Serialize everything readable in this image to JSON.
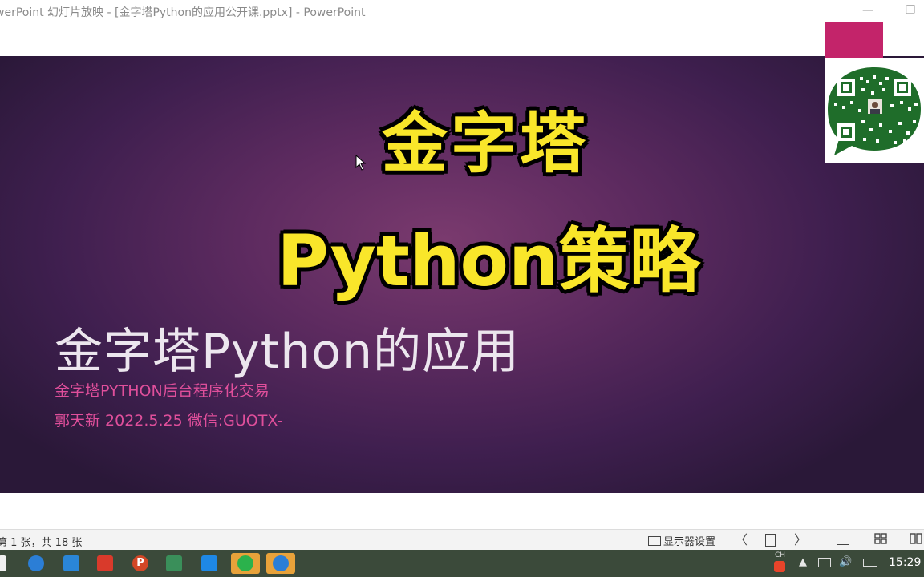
{
  "window": {
    "title": "werPoint 幻灯片放映 - [金字塔Python的应用公开课.pptx] - PowerPoint",
    "minimize_glyph": "—",
    "restore_glyph": "❐"
  },
  "slide": {
    "overlay_line1": "金字塔",
    "overlay_line2": "Python策略",
    "title": "金字塔Python的应用",
    "subtitle1": "金字塔PYTHON后台程序化交易",
    "subtitle2": "郭天新 2022.5.25 微信:GUOTX-"
  },
  "colors": {
    "overlay_text": "#f9e62a",
    "subtitle_text": "#e04f9b",
    "qr_header": "#c3246a"
  },
  "statusbar": {
    "slide_info": "第 1 张，共 18 张",
    "monitor_settings": "显示器设置",
    "prev_glyph": "〈",
    "next_glyph": "〉"
  },
  "taskbar": {
    "apps": [
      {
        "name": "windows-start"
      },
      {
        "name": "browser-q"
      },
      {
        "name": "bird-app"
      },
      {
        "name": "red-app"
      },
      {
        "name": "powerpoint",
        "label": "P"
      },
      {
        "name": "green-app"
      },
      {
        "name": "cloud-app"
      },
      {
        "name": "wechat"
      },
      {
        "name": "qq-browser"
      }
    ],
    "ime_label": "CH",
    "clock": "15:29"
  }
}
